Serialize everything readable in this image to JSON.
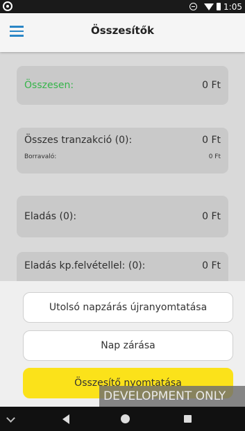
{
  "status_bar": {
    "time": "1:05",
    "icons": [
      "app-notification-icon",
      "do-not-disturb-icon",
      "wifi-icon",
      "battery-icon"
    ]
  },
  "app_bar": {
    "title": "Összesítők",
    "menu_icon": "hamburger-menu-icon"
  },
  "summary": {
    "total": {
      "label": "Összesen:",
      "value": "0 Ft"
    },
    "transactions": {
      "label": "Összes tranzakció (0):",
      "value": "0 Ft",
      "tip_label": "Borravaló:",
      "tip_value": "0 Ft"
    },
    "sales": {
      "label": "Eladás (0):",
      "value": "0 Ft"
    },
    "sales_cashback": {
      "label": "Eladás kp.felvétellel: (0):",
      "value": "0 Ft"
    }
  },
  "actions": {
    "reprint_label": "Utolsó napzárás újranyomtatása",
    "close_day_label": "Nap zárása",
    "print_summary_label": "Összesítő nyomtatása"
  },
  "watermark": "DEVELOPMENT ONLY",
  "colors": {
    "accent_blue": "#2a86c6",
    "total_green": "#35b44a",
    "primary_yellow": "#fbe21a"
  },
  "nav_bar": {
    "icons": [
      "chevron-down-icon",
      "back-icon",
      "home-icon",
      "recents-icon"
    ]
  }
}
